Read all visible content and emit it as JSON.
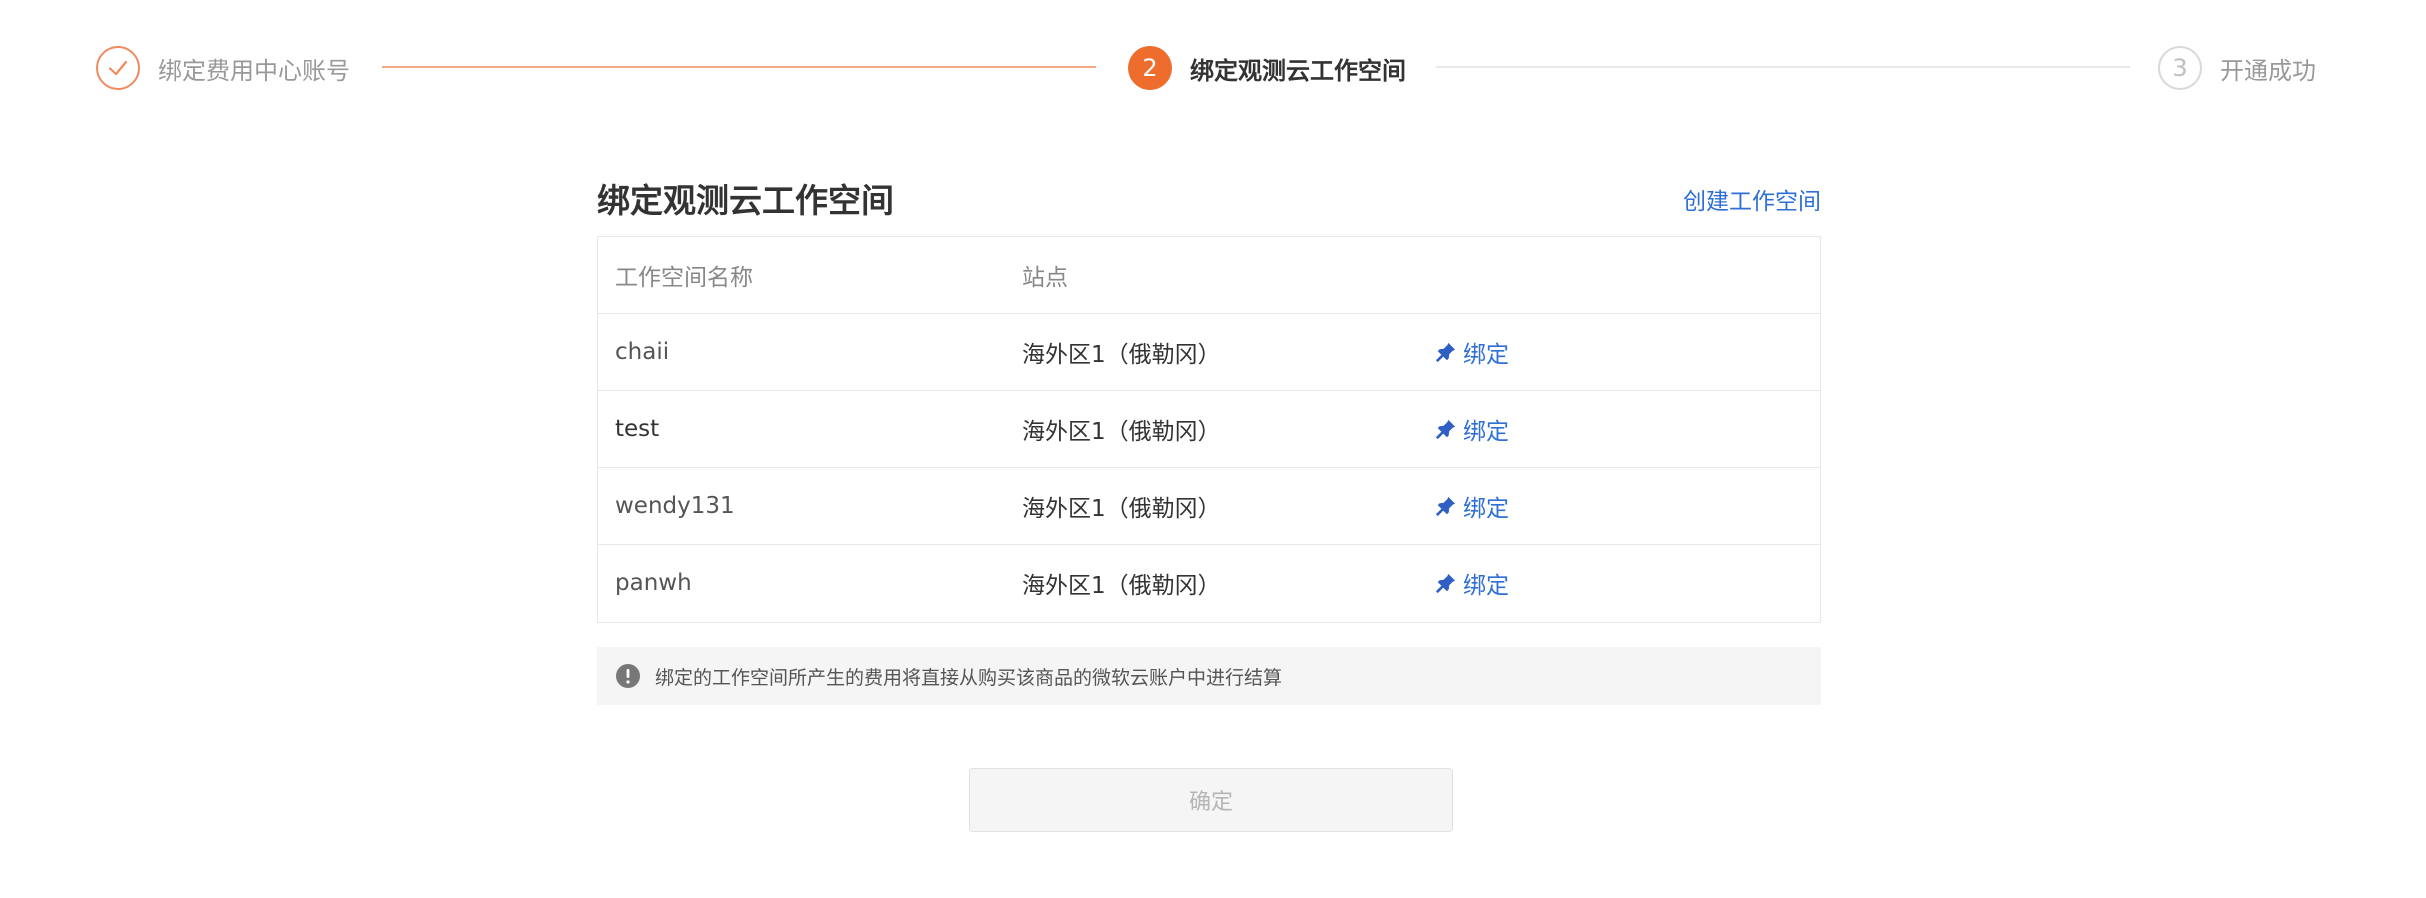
{
  "steps": [
    {
      "label": "绑定费用中心账号",
      "status": "done"
    },
    {
      "number": "2",
      "label": "绑定观测云工作空间",
      "status": "active"
    },
    {
      "number": "3",
      "label": "开通成功",
      "status": "pending"
    }
  ],
  "section": {
    "title": "绑定观测云工作空间",
    "create_link": "创建工作空间"
  },
  "table": {
    "headers": [
      "工作空间名称",
      "站点"
    ],
    "action_label": "绑定",
    "rows": [
      {
        "name": "chaii",
        "site": "海外区1（俄勒冈）"
      },
      {
        "name": "test",
        "site": "海外区1（俄勒冈）"
      },
      {
        "name": "wendy131",
        "site": "海外区1（俄勒冈）"
      },
      {
        "name": "panwh",
        "site": "海外区1（俄勒冈）"
      }
    ]
  },
  "notice": {
    "text": "绑定的工作空间所产生的费用将直接从购买该商品的微软云账户中进行结算"
  },
  "confirm_label": "确定",
  "colors": {
    "accent": "#ee6c2c",
    "link": "#2f6fd6"
  }
}
